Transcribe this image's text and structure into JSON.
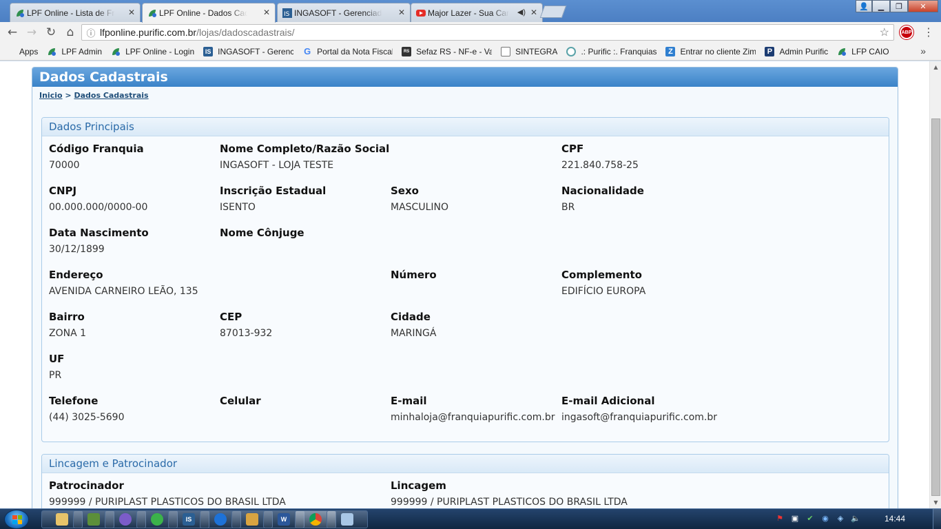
{
  "browser": {
    "tabs": [
      {
        "label": "LPF Online - Lista de Fran",
        "icon": "lpf-leaf-icon"
      },
      {
        "label": "LPF Online - Dados Cada",
        "icon": "lpf-leaf-icon"
      },
      {
        "label": "INGASOFT - Gerenciador",
        "icon": "ingasoft-icon"
      },
      {
        "label": "Major Lazer - Sua Car",
        "icon": "youtube-icon"
      }
    ],
    "url_host": "lfponline.purific.com.br",
    "url_path": "/lojas/dadoscadastrais/",
    "abp_label": "ABP",
    "bookmarks": [
      {
        "label": "Apps",
        "icon": "apps-grid-icon"
      },
      {
        "label": "LPF Admin",
        "icon": "lpf-leaf-icon"
      },
      {
        "label": "LPF Online - Login",
        "icon": "lpf-leaf-icon"
      },
      {
        "label": "INGASOFT - Gerencia",
        "icon": "ingasoft-icon"
      },
      {
        "label": "Portal da Nota Fiscal",
        "icon": "google-icon"
      },
      {
        "label": "Sefaz RS - NF-e - Vali",
        "icon": "sefaz-icon"
      },
      {
        "label": "SINTEGRA",
        "icon": "page-icon"
      },
      {
        "label": ".: Purific :. Franquias d",
        "icon": "purific-icon"
      },
      {
        "label": "Entrar no cliente Zim",
        "icon": "zimbra-icon"
      },
      {
        "label": "Admin Purific",
        "icon": "admin-icon"
      },
      {
        "label": "LFP CAIO",
        "icon": "lpf-leaf-icon"
      }
    ]
  },
  "page": {
    "title": "Dados Cadastrais",
    "breadcrumb": {
      "home": "Inicio",
      "separator": ">",
      "current": "Dados Cadastrais"
    },
    "sections": {
      "principais": {
        "title": "Dados Principais",
        "fields": {
          "codigo_franquia": {
            "label": "Código Franquia",
            "value": "70000"
          },
          "nome_completo": {
            "label": "Nome Completo/Razão Social",
            "value": "INGASOFT - LOJA TESTE"
          },
          "cpf": {
            "label": "CPF",
            "value": "221.840.758-25"
          },
          "cnpj": {
            "label": "CNPJ",
            "value": "00.000.000/0000-00"
          },
          "inscricao_estadual": {
            "label": "Inscrição Estadual",
            "value": "ISENTO"
          },
          "sexo": {
            "label": "Sexo",
            "value": "MASCULINO"
          },
          "nacionalidade": {
            "label": "Nacionalidade",
            "value": "BR"
          },
          "data_nascimento": {
            "label": "Data Nascimento",
            "value": "30/12/1899"
          },
          "nome_conjuge": {
            "label": "Nome Cônjuge",
            "value": ""
          },
          "endereco": {
            "label": "Endereço",
            "value": "AVENIDA CARNEIRO LEÃO, 135"
          },
          "numero": {
            "label": "Número",
            "value": ""
          },
          "complemento": {
            "label": "Complemento",
            "value": "EDIFÍCIO EUROPA"
          },
          "bairro": {
            "label": "Bairro",
            "value": "ZONA 1"
          },
          "cep": {
            "label": "CEP",
            "value": "87013-932"
          },
          "cidade": {
            "label": "Cidade",
            "value": "MARINGÁ"
          },
          "uf": {
            "label": "UF",
            "value": "PR"
          },
          "telefone": {
            "label": "Telefone",
            "value": "(44) 3025-5690"
          },
          "celular": {
            "label": "Celular",
            "value": ""
          },
          "email": {
            "label": "E-mail",
            "value": "minhaloja@franquiapurific.com.br"
          },
          "email_adicional": {
            "label": "E-mail Adicional",
            "value": "ingasoft@franquiapurific.com.br"
          }
        }
      },
      "lincagem": {
        "title": "Lincagem e Patrocinador",
        "fields": {
          "patrocinador": {
            "label": "Patrocinador",
            "value": "999999 / PURIPLAST PLASTICOS DO BRASIL LTDA"
          },
          "lincagem": {
            "label": "Lincagem",
            "value": "999999 / PURIPLAST PLASTICOS DO BRASIL LTDA"
          }
        }
      }
    }
  },
  "taskbar": {
    "clock": "14:44",
    "apps": [
      "explorer-icon",
      "network-icon",
      "media-icon",
      "green-app-icon",
      "ingasoft-icon",
      "teamviewer-icon",
      "paint-icon",
      "word-icon",
      "chrome-icon",
      "notepad-icon"
    ]
  },
  "colors": {
    "header_blue": "#3a83c8",
    "section_title": "#2a6aa8",
    "breadcrumb": "#1f4e79"
  }
}
